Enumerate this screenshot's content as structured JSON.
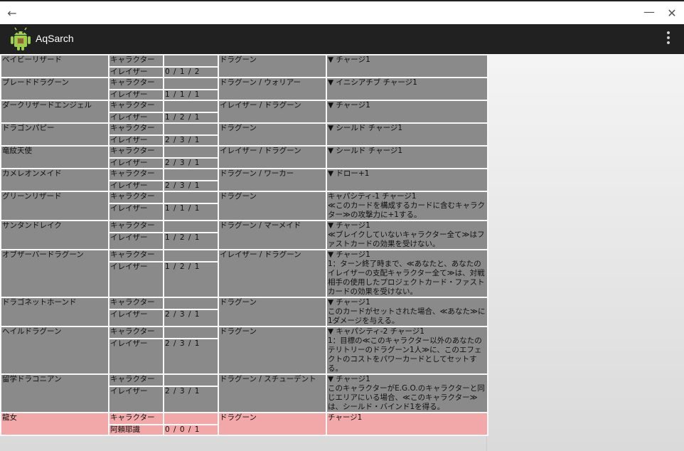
{
  "window": {
    "back": "←",
    "minimize": "—",
    "close": "✕"
  },
  "appbar": {
    "title": "AqSarch"
  },
  "cards": [
    {
      "name": "ベイビーリザード",
      "type1": "キャラクター",
      "type2": "イレイザー",
      "val1": "",
      "val2": "0 / 1 / 2",
      "tribe": "ドラグーン",
      "effect": "▼ チャージ1",
      "pink": false
    },
    {
      "name": "ブレードドラグーン",
      "type1": "キャラクター",
      "type2": "イレイザー",
      "val1": "",
      "val2": "1 / 1 / 1",
      "tribe": "ドラグーン / ウォリアー",
      "effect": "▼ イニシアチブ チャージ1",
      "pink": false
    },
    {
      "name": "ダークリザードエンジェル",
      "type1": "キャラクター",
      "type2": "イレイザー",
      "val1": "",
      "val2": "1 / 2 / 1",
      "tribe": "イレイザー / ドラグーン",
      "effect": "▼ チャージ1",
      "pink": false
    },
    {
      "name": "ドラゴンパピー",
      "type1": "キャラクター",
      "type2": "イレイザー",
      "val1": "",
      "val2": "2 / 3 / 1",
      "tribe": "ドラグーン",
      "effect": "▼ シールド チャージ1",
      "pink": false
    },
    {
      "name": "竜紋天使",
      "type1": "キャラクター",
      "type2": "イレイザー",
      "val1": "",
      "val2": "2 / 3 / 1",
      "tribe": "イレイザー / ドラグーン",
      "effect": "▼ シールド チャージ1",
      "pink": false
    },
    {
      "name": "カメレオンメイド",
      "type1": "キャラクター",
      "type2": "イレイザー",
      "val1": "",
      "val2": "2 / 3 / 1",
      "tribe": "ドラグーン / ワーカー",
      "effect": "▼ ドロー+1",
      "pink": false
    },
    {
      "name": "グリーンリザード",
      "type1": "キャラクター",
      "type2": "イレイザー",
      "val1": "",
      "val2": "1 / 1 / 1",
      "tribe": "ドラグーン",
      "effect": "キャパシティ-1 チャージ1\n≪このカードを構成するカードに含むキャラクター≫の攻撃力に+1する。",
      "pink": false
    },
    {
      "name": "サンタンドレイク",
      "type1": "キャラクター",
      "type2": "イレイザー",
      "val1": "",
      "val2": "1 / 2 / 1",
      "tribe": "ドラグーン / マーメイド",
      "effect": "▼ チャージ1\n≪ブレイクしていないキャラクター全て≫はファストカードの効果を受けない。",
      "pink": false
    },
    {
      "name": "オブザーバードラグーン",
      "type1": "キャラクター",
      "type2": "イレイザー",
      "val1": "",
      "val2": "1 / 2 / 1",
      "tribe": "イレイザー / ドラグーン",
      "effect": "▼ チャージ1\n1：ターン終了時まで、≪あなたと、あなたのイレイザーの支配キャラクター全て≫は、対戦相手の使用したプロジェクトカード・ファストカードの効果を受けない。",
      "pink": false
    },
    {
      "name": "ドラゴネットホーンド",
      "type1": "キャラクター",
      "type2": "イレイザー",
      "val1": "",
      "val2": "2 / 3 / 1",
      "tribe": "ドラグーン",
      "effect": "▼ チャージ1\nこのカードがセットされた場合、≪あなた≫に1ダメージを与える。",
      "pink": false
    },
    {
      "name": "ヘイルドラグーン",
      "type1": "キャラクター",
      "type2": "イレイザー",
      "val1": "",
      "val2": "2 / 3 / 1",
      "tribe": "ドラグーン",
      "effect": "▼ キャパシティ-2 チャージ1\n1：目標の≪このキャラクター以外のあなたのテリトリーのドラグーン1人≫に、このエフェクトのコストをパワーカードとしてセットする。",
      "pink": false
    },
    {
      "name": "留学ドラコニアン",
      "type1": "キャラクター",
      "type2": "イレイザー",
      "val1": "",
      "val2": "2 / 3 / 1",
      "tribe": "ドラグーン / スチューデント",
      "effect": "▼ チャージ1\nこのキャラクターがE.G.O.のキャラクターと同じエリアにいる場合、≪このキャラクター≫は、シールド・バインド1を得る。",
      "pink": false
    },
    {
      "name": "龍女",
      "type1": "キャラクター",
      "type2": "阿頼耶識",
      "val1": "",
      "val2": "0 / 0 / 1",
      "tribe": "ドラグーン",
      "effect": "チャージ1",
      "pink": true
    }
  ]
}
